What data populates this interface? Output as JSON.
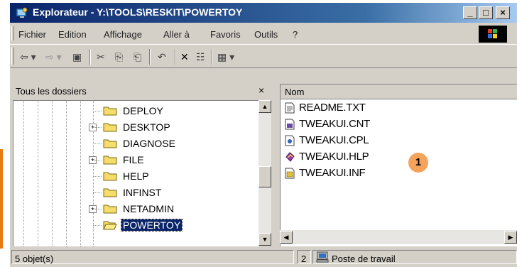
{
  "window": {
    "title": "Explorateur - Y:\\TOOLS\\RESKIT\\POWERTOY",
    "minimize": "_",
    "maximize": "□",
    "close": "×"
  },
  "menu": [
    {
      "label": "Fichier"
    },
    {
      "label": "Edition"
    },
    {
      "label": "Affichage"
    },
    {
      "label": "Aller à"
    },
    {
      "label": "Favoris"
    },
    {
      "label": "Outils"
    },
    {
      "label": "?"
    }
  ],
  "toolbar": {
    "icons": [
      "back-icon",
      "forward-icon",
      "up-folder-icon",
      "cut-icon",
      "copy-icon",
      "paste-icon",
      "undo-icon",
      "delete-icon",
      "properties-icon",
      "views-icon"
    ],
    "back": "⇦ ▾",
    "forward": "⇨ ▾",
    "up": "▣",
    "cut": "✂",
    "copy": "⎘",
    "paste": "⎗",
    "undo": "↶",
    "delete": "✕",
    "properties": "☷",
    "views": "▦ ▾"
  },
  "folders_panel": {
    "title": "Tous les dossiers",
    "close": "×",
    "items": [
      {
        "label": "DEPLOY",
        "expandable": false,
        "selected": false
      },
      {
        "label": "DESKTOP",
        "expandable": true,
        "selected": false
      },
      {
        "label": "DIAGNOSE",
        "expandable": false,
        "selected": false
      },
      {
        "label": "FILE",
        "expandable": true,
        "selected": false
      },
      {
        "label": "HELP",
        "expandable": false,
        "selected": false
      },
      {
        "label": "INFINST",
        "expandable": false,
        "selected": false
      },
      {
        "label": "NETADMIN",
        "expandable": true,
        "selected": false
      },
      {
        "label": "POWERTOY",
        "expandable": false,
        "selected": true
      }
    ]
  },
  "files_panel": {
    "column": "Nom",
    "files": [
      {
        "name": "README.TXT",
        "icon": "text-file-icon"
      },
      {
        "name": "TWEAKUI.CNT",
        "icon": "help-contents-icon"
      },
      {
        "name": "TWEAKUI.CPL",
        "icon": "control-panel-icon"
      },
      {
        "name": "TWEAKUI.HLP",
        "icon": "help-file-icon"
      },
      {
        "name": "TWEAKUI.INF",
        "icon": "setup-info-icon"
      }
    ],
    "callout": "1"
  },
  "status": {
    "count": "5 objet(s)",
    "size": "2",
    "location": "Poste de travail"
  },
  "colors": {
    "titlebar": "#0a246a",
    "selection": "#0a246a",
    "callout": "#f5a25a",
    "face": "#d4d0c8"
  }
}
